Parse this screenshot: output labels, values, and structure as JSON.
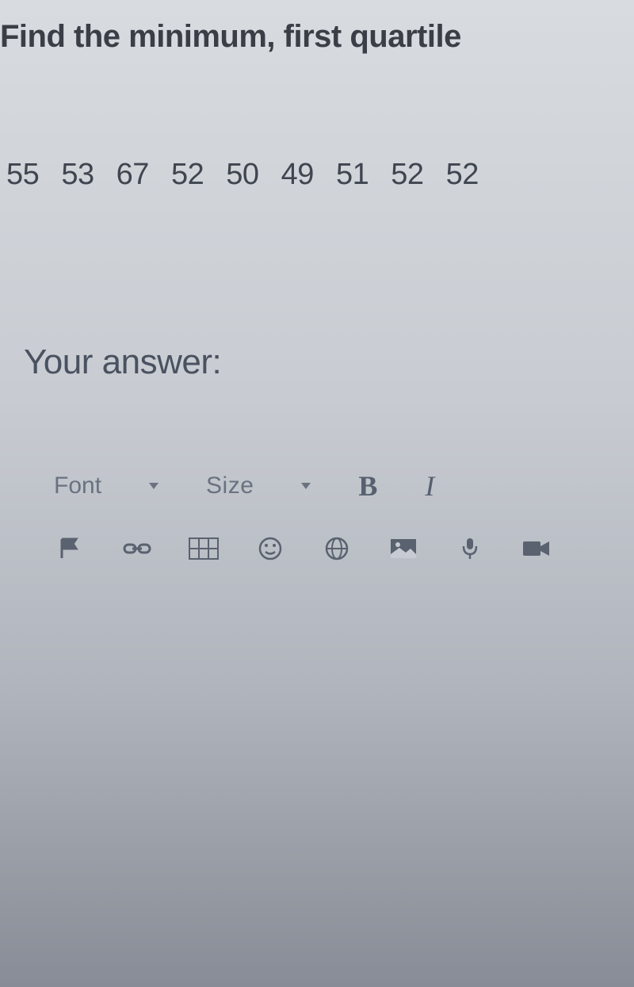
{
  "question": {
    "prompt": "Find the minimum, first quartile",
    "data_values": "55 53 67 52 50 49 51 52 52"
  },
  "answer": {
    "label": "Your answer:"
  },
  "toolbar": {
    "font_label": "Font",
    "size_label": "Size",
    "bold_label": "B",
    "italic_label": "I"
  }
}
